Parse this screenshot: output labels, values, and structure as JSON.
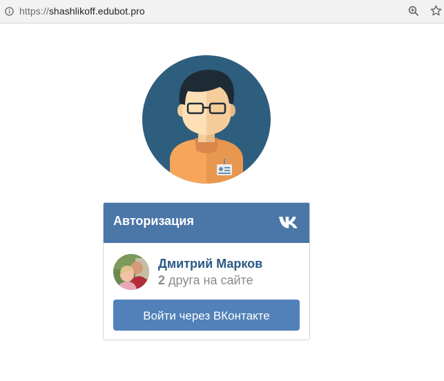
{
  "browser": {
    "url_scheme": "https://",
    "url_host": "shashlikoff.edubot.pro",
    "icons": [
      "info-icon",
      "zoom-icon",
      "bookmark-star-icon"
    ]
  },
  "avatar": {
    "icon": "user-avatar-illustration"
  },
  "widget": {
    "title": "Авторизация",
    "brand_icon": "vk-logo-icon",
    "user_name": "Дмитрий Марков",
    "friends_count": "2",
    "friends_text": "друга на сайте",
    "login_button_label": "Войти через ВКонтакте",
    "colors": {
      "header": "#4a76a8",
      "button": "#5181b8",
      "name": "#2a5885"
    }
  }
}
